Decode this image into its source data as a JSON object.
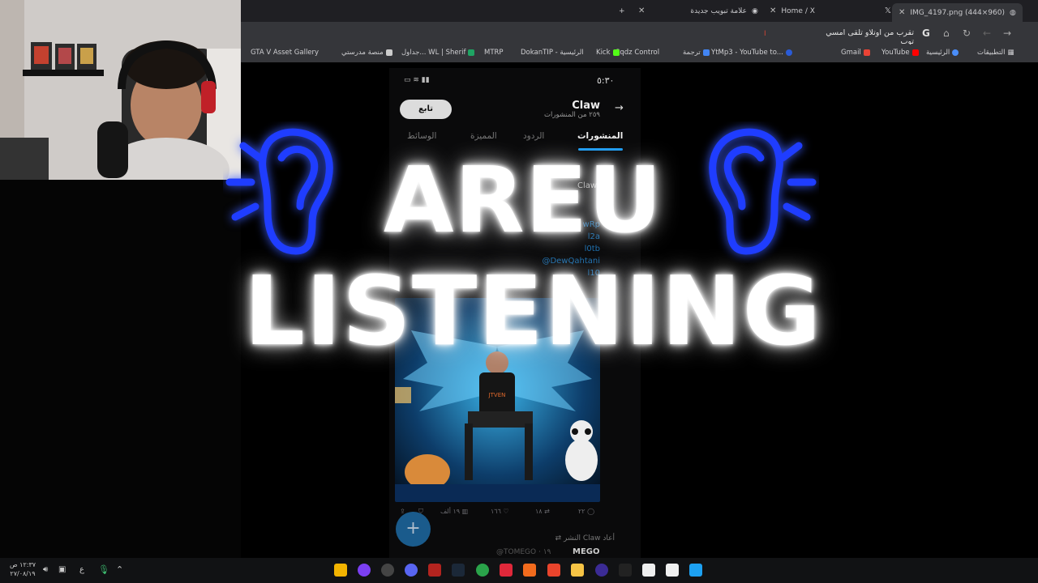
{
  "tabs": [
    {
      "label": "IMG_4197.png (444×960)",
      "active": true
    },
    {
      "label": "Home / X",
      "active": false
    },
    {
      "label": "علامة تبويب جديدة",
      "active": false
    }
  ],
  "address": {
    "value": "تقرب من اوتلاو تلقى امسي توب"
  },
  "bookmarks": [
    "التطبيقات",
    "الرئيسية",
    "YouTube",
    "Gmail",
    "YtMp3 - YouTube to...",
    "ترجمة",
    "Sqdz Control",
    "Kick",
    "DokanTIP - الرئيسية",
    "MTRP",
    "جداول... WL | Sherif",
    "منصة مدرستي",
    "GTA V Asset Gallery"
  ],
  "phone": {
    "time": "٥:٣٠",
    "profile_name": "Claw",
    "post_count": "٢٥٩ من المنشورات",
    "follow_button": "تابع",
    "tabs": [
      "المنشورات",
      "الردود",
      "المميزة",
      "الوسائط"
    ],
    "post_name": "Claw",
    "handles": [
      "wRp",
      "l2a",
      "l0tb",
      "@DewQahtani",
      "l10"
    ],
    "actions": {
      "replies": "٢٢",
      "reposts": "١٨",
      "likes": "١٦٦",
      "views": "١٩ ألف"
    },
    "repost_text": "أعاد Claw النشر",
    "bottom_user": "MEGO",
    "bottom_handle": "@TOMEGO · ١٩"
  },
  "thumbnail_text": {
    "line1": "AREU",
    "line2": "LISTENING"
  },
  "taskbar": {
    "time": "١٢:٣٧ ص",
    "date": "٢٧/٠٨/١٩",
    "lang": "ع"
  },
  "colors": {
    "ear_blue": "#1f3dff",
    "tab_accent": "#1d9bf0"
  }
}
